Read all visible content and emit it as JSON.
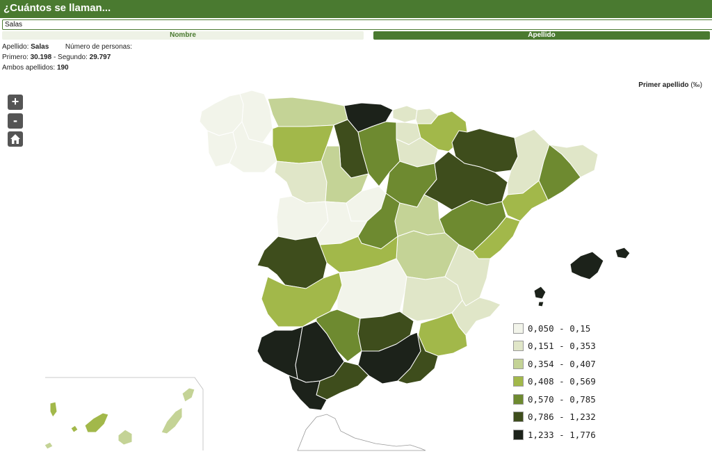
{
  "header": {
    "title": "¿Cuántos se llaman..."
  },
  "search": {
    "value": "Salas"
  },
  "tabs": [
    {
      "label": "Nombre",
      "active": false
    },
    {
      "label": "Apellido",
      "active": true
    }
  ],
  "info": {
    "apellido_label": "Apellido:",
    "apellido_value": "Salas",
    "personas_label": "Número de personas:",
    "primero_label": "Primero:",
    "primero_value": "30.198",
    "segundo_label": "- Segundo:",
    "segundo_value": "29.797",
    "ambos_label": "Ambos apellidos:",
    "ambos_value": "190"
  },
  "map": {
    "title": "Primer apellido",
    "unit": "(‰)",
    "zoom_in_label": "+",
    "zoom_out_label": "-",
    "home_icon": "home-icon"
  },
  "legend": [
    {
      "label": "0,050 - 0,15",
      "color": "#f2f4ea"
    },
    {
      "label": "0,151 - 0,353",
      "color": "#e0e6c8"
    },
    {
      "label": "0,354 - 0,407",
      "color": "#c4d396"
    },
    {
      "label": "0,408 - 0,569",
      "color": "#a2b84a"
    },
    {
      "label": "0,570 - 0,785",
      "color": "#6e8a30"
    },
    {
      "label": "0,786 - 1,232",
      "color": "#3e4d1c"
    },
    {
      "label": "1,233 - 1,776",
      "color": "#1c221a"
    }
  ]
}
